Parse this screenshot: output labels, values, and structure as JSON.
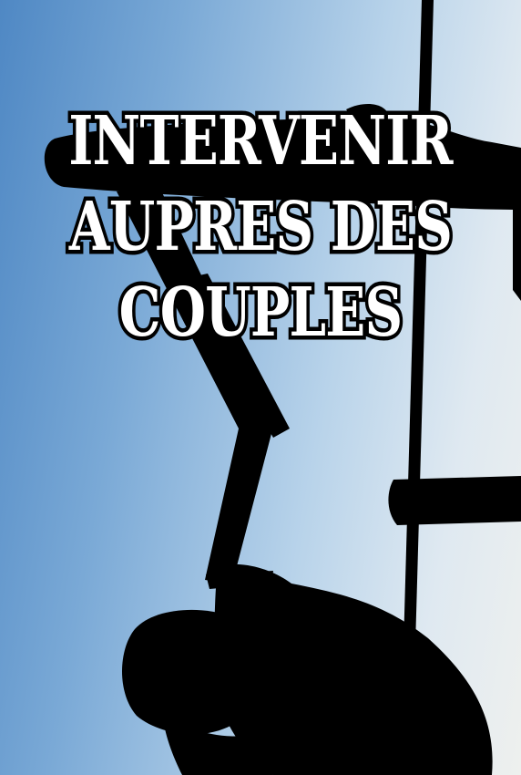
{
  "cover": {
    "title_lines": [
      "INTERVENIR",
      "AUPRES DES",
      "COUPLES"
    ]
  },
  "colors": {
    "sky_left": "#4f88c4",
    "sky_right": "#eef0ee",
    "silhouette": "#000000",
    "title_fill": "#ffffff",
    "title_outline": "#000000"
  }
}
